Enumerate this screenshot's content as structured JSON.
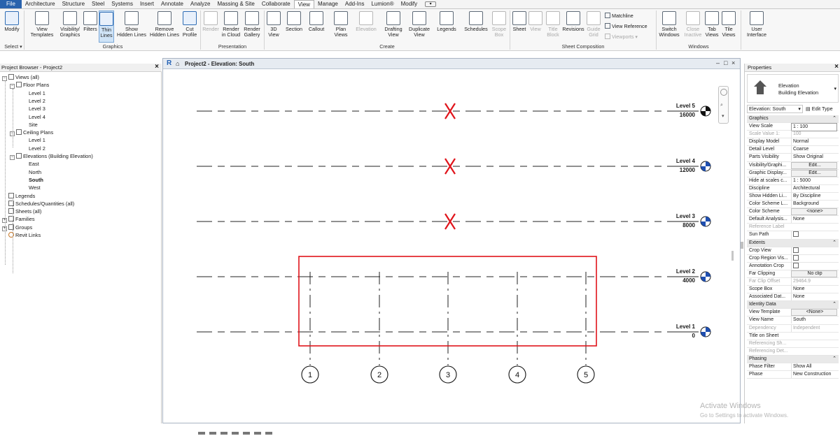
{
  "tabs": [
    "File",
    "Architecture",
    "Structure",
    "Steel",
    "Systems",
    "Insert",
    "Annotate",
    "Analyze",
    "Massing & Site",
    "Collaborate",
    "View",
    "Manage",
    "Add-Ins",
    "Lumion®",
    "Modify"
  ],
  "active_tab": "View",
  "ribbon": {
    "select_label": "Select ▾",
    "graphics": {
      "modify": "Modify",
      "view_templates": [
        "View",
        "Templates"
      ],
      "visibility_graphics": [
        "Visibility/",
        "Graphics"
      ],
      "filters": "Filters",
      "thin_lines": [
        "Thin",
        "Lines"
      ],
      "show_hidden_lines": [
        "Show",
        "Hidden Lines"
      ],
      "remove_hidden_lines": [
        "Remove",
        "Hidden Lines"
      ],
      "cut_profile": [
        "Cut",
        "Profile"
      ],
      "group_label": "Graphics"
    },
    "presentation": {
      "render": "Render",
      "render_cloud": [
        "Render",
        "in Cloud"
      ],
      "render_gallery": [
        "Render",
        "Gallery"
      ],
      "group_label": "Presentation"
    },
    "create": {
      "3d_view": [
        "3D",
        "View"
      ],
      "section": "Section",
      "callout": "Callout",
      "plan_views": [
        "Plan",
        "Views"
      ],
      "elevation": "Elevation",
      "drafting_view": [
        "Drafting",
        "View"
      ],
      "duplicate_view": [
        "Duplicate",
        "View"
      ],
      "legends": "Legends",
      "schedules": "Schedules",
      "scope_box": [
        "Scope",
        "Box"
      ],
      "group_label": "Create"
    },
    "sheet": {
      "sheet": "Sheet",
      "view": "View",
      "title_block": [
        "Title",
        "Block"
      ],
      "revisions": "Revisions",
      "guide_grid": [
        "Guide",
        "Grid"
      ],
      "matchline": "Matchline",
      "view_reference": "View  Reference",
      "viewports": "Viewports ▾",
      "group_label": "Sheet Composition"
    },
    "windows": {
      "switch_windows": [
        "Switch",
        "Windows"
      ],
      "close_inactive": [
        "Close",
        "Inactive"
      ],
      "tab_views": [
        "Tab",
        "Views"
      ],
      "tile_views": [
        "Tile",
        "Views"
      ],
      "user_interface": [
        "User",
        "Interface"
      ],
      "group_label": "Windows"
    }
  },
  "browser": {
    "title": "Project Browser - Project2",
    "items": [
      {
        "label": "Views (all)",
        "depth": 0
      },
      {
        "label": "Floor Plans",
        "depth": 1
      },
      {
        "label": "Level 1",
        "depth": 2
      },
      {
        "label": "Level 2",
        "depth": 2
      },
      {
        "label": "Level 3",
        "depth": 2
      },
      {
        "label": "Level 4",
        "depth": 2
      },
      {
        "label": "Site",
        "depth": 2
      },
      {
        "label": "Ceiling Plans",
        "depth": 1
      },
      {
        "label": "Level 1",
        "depth": 2
      },
      {
        "label": "Level 2",
        "depth": 2
      },
      {
        "label": "Elevations (Building Elevation)",
        "depth": 1
      },
      {
        "label": "East",
        "depth": 2
      },
      {
        "label": "North",
        "depth": 2
      },
      {
        "label": "South",
        "depth": 2,
        "selected": true
      },
      {
        "label": "West",
        "depth": 2
      },
      {
        "label": "Legends",
        "depth": 0
      },
      {
        "label": "Schedules/Quantities (all)",
        "depth": 0
      },
      {
        "label": "Sheets (all)",
        "depth": 0
      },
      {
        "label": "Families",
        "depth": 0
      },
      {
        "label": "Groups",
        "depth": 0
      },
      {
        "label": "Revit Links",
        "depth": 0
      }
    ]
  },
  "view": {
    "title": "Project2 - Elevation: South",
    "levels": [
      {
        "name": "Level 5",
        "value": "16000",
        "marker": "black"
      },
      {
        "name": "Level 4",
        "value": "12000",
        "marker": "blue"
      },
      {
        "name": "Level 3",
        "value": "8000",
        "marker": "blue"
      },
      {
        "name": "Level 2",
        "value": "4000",
        "marker": "blue"
      },
      {
        "name": "Level 1",
        "value": "0",
        "marker": "blue"
      }
    ],
    "grids": [
      "1",
      "2",
      "3",
      "4",
      "5"
    ],
    "highlight_color": "#e0141b",
    "x_mark_color": "#e0141b"
  },
  "properties": {
    "title": "Properties",
    "type_line1": "Elevation",
    "type_line2": "Building Elevation",
    "instance": "Elevation: South",
    "edit_type": "Edit Type",
    "rows": [
      {
        "section": "Graphics"
      },
      {
        "k": "View Scale",
        "v": "1 : 100",
        "style": "input"
      },
      {
        "k": "Scale Value    1:",
        "v": "100",
        "dis": true
      },
      {
        "k": "Display Model",
        "v": "Normal"
      },
      {
        "k": "Detail Level",
        "v": "Coarse"
      },
      {
        "k": "Parts Visibility",
        "v": "Show Original"
      },
      {
        "k": "Visibility/Graphi...",
        "v": "Edit...",
        "style": "btn"
      },
      {
        "k": "Graphic Display...",
        "v": "Edit...",
        "style": "btn"
      },
      {
        "k": "Hide at scales c...",
        "v": "1 : 5000"
      },
      {
        "k": "Discipline",
        "v": "Architectural"
      },
      {
        "k": "Show Hidden Li...",
        "v": "By Discipline"
      },
      {
        "k": "Color Scheme L...",
        "v": "Background"
      },
      {
        "k": "Color Scheme",
        "v": "<none>",
        "style": "btn"
      },
      {
        "k": "Default Analysis...",
        "v": "None"
      },
      {
        "k": "Reference Label",
        "v": "",
        "dis": true
      },
      {
        "k": "Sun Path",
        "v": "",
        "style": "cb"
      },
      {
        "section": "Extents"
      },
      {
        "k": "Crop View",
        "v": "",
        "style": "cb"
      },
      {
        "k": "Crop Region Vis...",
        "v": "",
        "style": "cb"
      },
      {
        "k": "Annotation Crop",
        "v": "",
        "style": "cb"
      },
      {
        "k": "Far Clipping",
        "v": "No clip",
        "style": "btn"
      },
      {
        "k": "Far Clip Offset",
        "v": "29464.9",
        "dis": true
      },
      {
        "k": "Scope Box",
        "v": "None"
      },
      {
        "k": "Associated Dat...",
        "v": "None"
      },
      {
        "section": "Identity Data"
      },
      {
        "k": "View Template",
        "v": "<None>",
        "style": "btn"
      },
      {
        "k": "View Name",
        "v": "South"
      },
      {
        "k": "Dependency",
        "v": "Independent",
        "dis": true
      },
      {
        "k": "Title on Sheet",
        "v": ""
      },
      {
        "k": "Referencing Sh...",
        "v": "",
        "dis": true
      },
      {
        "k": "Referencing Det...",
        "v": "",
        "dis": true
      },
      {
        "section": "Phasing"
      },
      {
        "k": "Phase Filter",
        "v": "Show All"
      },
      {
        "k": "Phase",
        "v": "New Construction"
      }
    ]
  },
  "watermark": {
    "line1": "Activate Windows",
    "line2": "Go to Settings to activate Windows."
  }
}
